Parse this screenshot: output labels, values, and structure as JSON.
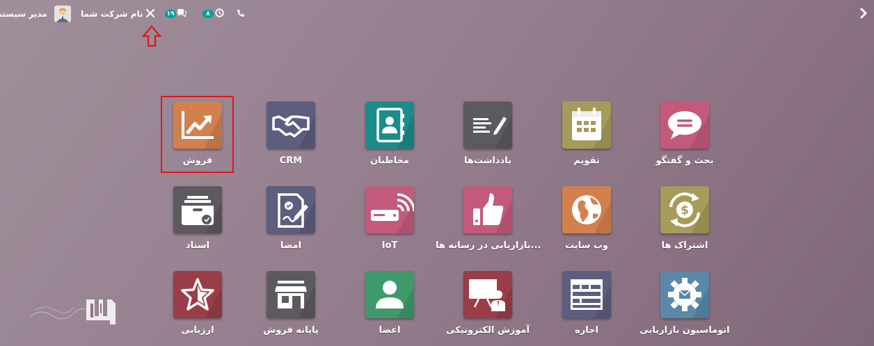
{
  "topbar": {
    "user_name": "مدیر سیستم",
    "company_name": "نام شرکت شما",
    "messages_count": "۱۹",
    "activities_count": "۸"
  },
  "apps": [
    {
      "label": "بحث و گفتگو",
      "icon": "chat-bubble-icon",
      "color": "#c35a7b"
    },
    {
      "label": "تقویم",
      "icon": "calendar-icon",
      "color": "#a59b5a"
    },
    {
      "label": "یادداشت‌ها",
      "icon": "notes-pen-icon",
      "color": "#5d5a5f"
    },
    {
      "label": "مخاطبان",
      "icon": "address-book-icon",
      "color": "#1c8c8a"
    },
    {
      "label": "CRM",
      "icon": "handshake-icon",
      "color": "#5d5d7d"
    },
    {
      "label": "فروش",
      "icon": "sales-chart-icon",
      "color": "#d3804f"
    },
    {
      "label": "اشتراک ها",
      "icon": "subscription-dollar-icon",
      "color": "#a59b5a"
    },
    {
      "label": "وب سایت",
      "icon": "globe-icon",
      "color": "#d3804f"
    },
    {
      "label": "بازاریابی در رسانه ها...",
      "icon": "thumbs-up-icon",
      "color": "#c35a7b"
    },
    {
      "label": "IoT",
      "icon": "iot-device-icon",
      "color": "#c35a7b"
    },
    {
      "label": "امضا",
      "icon": "sign-document-icon",
      "color": "#5d5d7d"
    },
    {
      "label": "اسناد",
      "icon": "documents-inbox-icon",
      "color": "#5d5a5f"
    },
    {
      "label": "اتوماسیون بازاریابی",
      "icon": "gear-envelope-icon",
      "color": "#5a88a8"
    },
    {
      "label": "اجاره",
      "icon": "rental-calendar-icon",
      "color": "#5d5d7d"
    },
    {
      "label": "آموزش الکترونیکی",
      "icon": "presentation-icon",
      "color": "#9a3d48"
    },
    {
      "label": "اعضا",
      "icon": "member-user-icon",
      "color": "#3e9a6a"
    },
    {
      "label": "پایانه فروش",
      "icon": "shop-icon",
      "color": "#5d5a5f"
    },
    {
      "label": "ارزیابی",
      "icon": "star-icon",
      "color": "#9a3d48"
    }
  ]
}
